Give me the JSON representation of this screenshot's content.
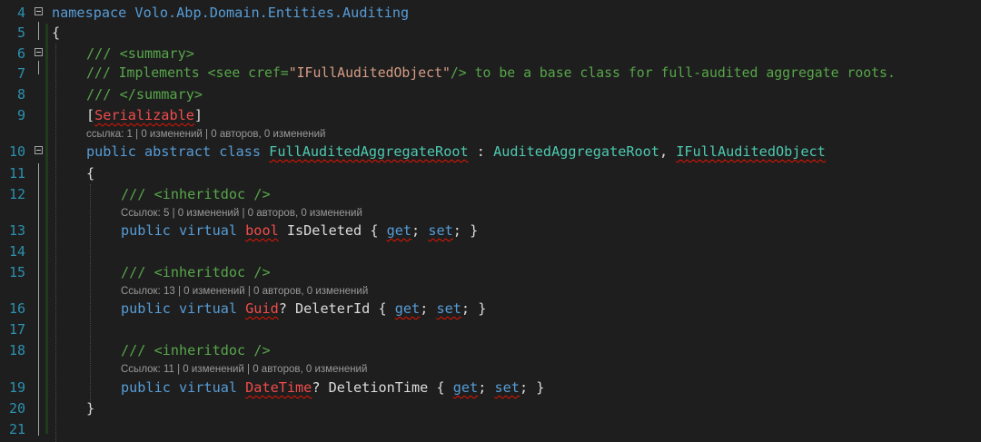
{
  "editor": {
    "lines": [
      {
        "n": "4",
        "text": "namespace Volo.Abp.Domain.Entities.Auditing"
      },
      {
        "n": "5",
        "text": "{"
      },
      {
        "n": "6",
        "text": "/// <summary>"
      },
      {
        "n": "7",
        "parts": [
          "/// Implements <see cref=",
          "\"IFullAuditedObject\"",
          "/> to be a base class for full-audited aggregate roots."
        ]
      },
      {
        "n": "8",
        "text": "/// </summary>"
      },
      {
        "n": "9",
        "parts": [
          "[",
          "Serializable",
          "]"
        ]
      },
      {
        "n": "10",
        "parts": [
          "public abstract class ",
          "FullAuditedAggregateRoot",
          " : ",
          "AuditedAggregateRoot",
          ", ",
          "IFullAuditedObject"
        ]
      },
      {
        "n": "11",
        "text": "{"
      },
      {
        "n": "12",
        "text": "/// <inheritdoc />"
      },
      {
        "n": "13",
        "parts": [
          "public virtual ",
          "bool",
          " IsDeleted { ",
          "get",
          "; ",
          "set",
          "; }"
        ]
      },
      {
        "n": "14",
        "text": ""
      },
      {
        "n": "15",
        "text": "/// <inheritdoc />"
      },
      {
        "n": "16",
        "parts": [
          "public virtual ",
          "Guid",
          "? DeleterId { ",
          "get",
          "; ",
          "set",
          "; }"
        ]
      },
      {
        "n": "17",
        "text": ""
      },
      {
        "n": "18",
        "text": "/// <inheritdoc />"
      },
      {
        "n": "19",
        "parts": [
          "public virtual ",
          "DateTime",
          "? DeletionTime { ",
          "get",
          "; ",
          "set",
          "; }"
        ]
      },
      {
        "n": "20",
        "text": "}"
      },
      {
        "n": "21",
        "text": ""
      }
    ],
    "codelens": {
      "class_lens": "ссылка: 1 | 0 изменений | 0 авторов, 0 изменений",
      "isdeleted_lens": "Ссылок: 5 | 0 изменений | 0 авторов, 0 изменений",
      "deleterid_lens": "Ссылок: 13 | 0 изменений | 0 авторов, 0 изменений",
      "deletiontime_lens": "Ссылок: 11 | 0 изменений | 0 авторов, 0 изменений"
    }
  },
  "colors": {
    "background": "#1e1e1e",
    "line_number": "#2b91af",
    "keyword": "#569cd6",
    "comment": "#57a64a",
    "type": "#4ec9b0",
    "string": "#d69d85",
    "error": "#f14c4c",
    "codelens": "#999999"
  },
  "icons": [
    "collapse-icon"
  ]
}
